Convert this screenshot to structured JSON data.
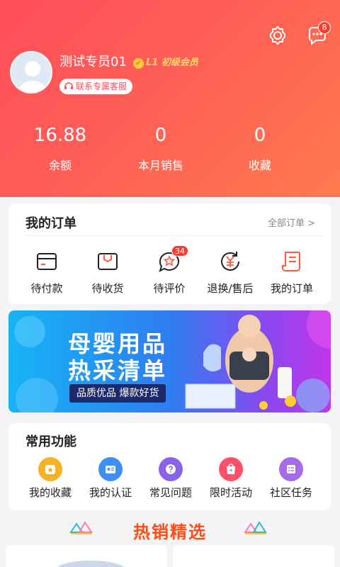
{
  "header": {
    "username": "测试专员01",
    "level_text": "L1 初级会员",
    "service_button": "联系专属客服",
    "message_badge": "8",
    "icons": [
      "gear-icon",
      "chat-icon",
      "headset-icon",
      "avatar-silhouette-icon",
      "check-badge-icon"
    ],
    "stats": [
      {
        "value": "16.88",
        "label": "余额"
      },
      {
        "value": "0",
        "label": "本月销售"
      },
      {
        "value": "0",
        "label": "收藏"
      }
    ]
  },
  "orders": {
    "title": "我的订单",
    "all_link": "全部订单 >",
    "items": [
      {
        "label": "待付款",
        "icon": "wallet-icon"
      },
      {
        "label": "待收货",
        "icon": "package-icon"
      },
      {
        "label": "待评价",
        "icon": "star-review-icon",
        "badge": "34"
      },
      {
        "label": "退换/售后",
        "icon": "refund-icon"
      },
      {
        "label": "我的订单",
        "icon": "order-list-icon"
      }
    ]
  },
  "banner": {
    "line1": "母婴用品",
    "line2": "热采清单",
    "tagline": "品质优品 爆款好货"
  },
  "functions": {
    "title": "常用功能",
    "items": [
      {
        "label": "我的收藏",
        "icon": "favorite-icon",
        "color": "#f5b324"
      },
      {
        "label": "我的认证",
        "icon": "id-card-icon",
        "color": "#3d8ff5"
      },
      {
        "label": "常见问题",
        "icon": "question-icon",
        "color": "#8a63e8"
      },
      {
        "label": "限时活动",
        "icon": "bolt-bag-icon",
        "color": "#ff4f6b"
      },
      {
        "label": "社区任务",
        "icon": "task-list-icon",
        "color": "#a66be8"
      }
    ]
  },
  "hot": {
    "title": "热销精选"
  },
  "colors": {
    "header_gradient_start": "#ff4e5a",
    "header_gradient_end": "#ff7a4d",
    "accent": "#ff4d17",
    "level_gold": "#ffd66b"
  }
}
